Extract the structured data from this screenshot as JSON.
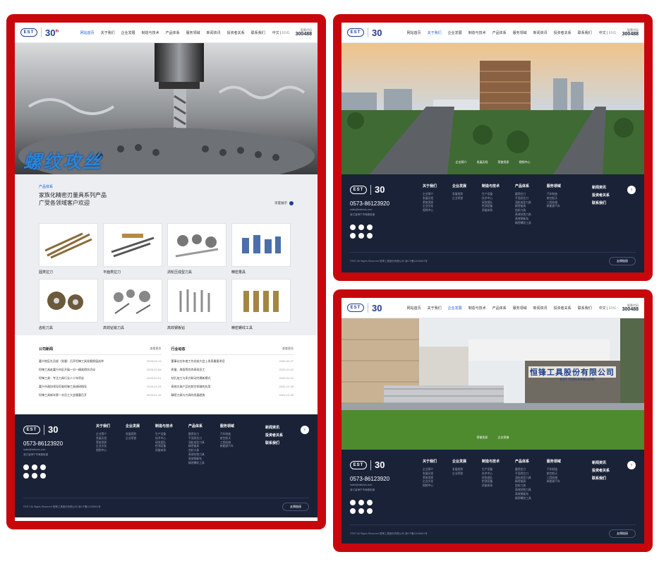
{
  "colors": {
    "frame": "#c8070c",
    "accent": "#1f5fd0",
    "brand": "#1f3f8f",
    "footer": "#1a2238"
  },
  "header": {
    "logo_text": "EST",
    "logo_30": "30",
    "nav": [
      "网站首页",
      "关于我们",
      "企业发展",
      "制造与技术",
      "产品体系",
      "服务领域",
      "新闻资讯",
      "投资者关系",
      "联系我们"
    ],
    "lang_cn": "中文",
    "lang_en": "ENG",
    "tel_label": "股票代码",
    "tel_code": "300488"
  },
  "site1": {
    "hero_title": "螺纹攻丝",
    "products": {
      "tag": "产品体系",
      "title_line1": "家族化精密刃量具系列产品",
      "title_line2": "广受各领域客户欢迎",
      "more": "深度展示",
      "items": [
        {
          "label": "圆类拉刀",
          "icon": "broach-icon"
        },
        {
          "label": "平面类拉刀",
          "icon": "flat-broach-icon"
        },
        {
          "label": "涡轮压成型刀具",
          "icon": "turbine-tool-icon"
        },
        {
          "label": "精密量具",
          "icon": "gauge-icon"
        },
        {
          "label": "齿轮刀具",
          "icon": "gear-tool-icon"
        },
        {
          "label": "高效钻铣刀具",
          "icon": "drill-icon"
        },
        {
          "label": "高效钢板钻",
          "icon": "plate-drill-icon"
        },
        {
          "label": "精密螺纹工具",
          "icon": "thread-tool-icon"
        }
      ]
    },
    "news": {
      "col1_title": "公司新闻",
      "col2_title": "行业动态",
      "more": "查看更多",
      "col1": [
        {
          "text": "嘉兴地区社员部（党委）召开恒锋工具党委换届选举",
          "date": "2025-02-13"
        },
        {
          "text": "恒锋工具赴嘉兴市区开展一对一精准帮扶活动",
          "date": "2025-02-08"
        },
        {
          "text": "恒锋工具：专注刀具行业二十年积淀",
          "date": "2025-02-01"
        },
        {
          "text": "嘉兴市政协领导莅临恒锋工具调研指导",
          "date": "2025-01-23"
        },
        {
          "text": "恒锋工具新年第一次员工大会隆重召开",
          "date": "2025-01-15"
        }
      ],
      "col2": [
        {
          "text": "董事长在年度工作总结大会上发表重要讲话",
          "date": "2025-02-07"
        },
        {
          "text": "质量、周段等优秀表现员工",
          "date": "2025-01-22"
        },
        {
          "text": "钻孔加工与多方联动共建新模式",
          "date": "2025-01-22"
        },
        {
          "text": "高效刃具产品在航空领域的应用",
          "date": "2024-12-28"
        },
        {
          "text": "精密刀具与刃具的发展趋势",
          "date": "2024-12-08"
        }
      ]
    }
  },
  "footer": {
    "phone": "0573-86123920",
    "email": "sales@esttools.com",
    "address": "浙江省海宁市海昌街道",
    "cols": [
      {
        "title": "关于我们",
        "items": [
          "企业简介",
          "发展历程",
          "荣誉资质",
          "企业文化",
          "视频中心"
        ]
      },
      {
        "title": "企业发展",
        "items": [
          "发展规划",
          "企业荣誉"
        ]
      },
      {
        "title": "制造与技术",
        "items": [
          "生产设备",
          "技术中心",
          "研发团队",
          "检测设备",
          "质量体系"
        ]
      },
      {
        "title": "产品体系",
        "items": [
          "圆类拉刀",
          "平面类拉刀",
          "涡轮成型刀具",
          "精密量具",
          "齿轮刀具",
          "高效钻铣刀具",
          "高效钢板钻",
          "精密螺纹工具"
        ]
      },
      {
        "title": "服务领域",
        "items": [
          "汽车制造",
          "航空航天",
          "工程机械",
          "新能源汽车"
        ]
      }
    ],
    "extra": [
      "新闻资讯",
      "投资者关系",
      "联系我们"
    ],
    "copyright": "©EST All Rights Reserved 恒锋工具股份有限公司 浙ICP备12026691号",
    "select_label": "友情链接"
  },
  "site2": {
    "hero_dots": [
      "企业简介",
      "发展历程",
      "荣誉资质",
      "视频中心"
    ]
  },
  "site3": {
    "sign": "恒锋工具股份有限公司",
    "sign_en": "EST TOOLS CO.,LTD",
    "hero_dots": [
      "荣誉资质",
      "企业荣誉"
    ]
  }
}
